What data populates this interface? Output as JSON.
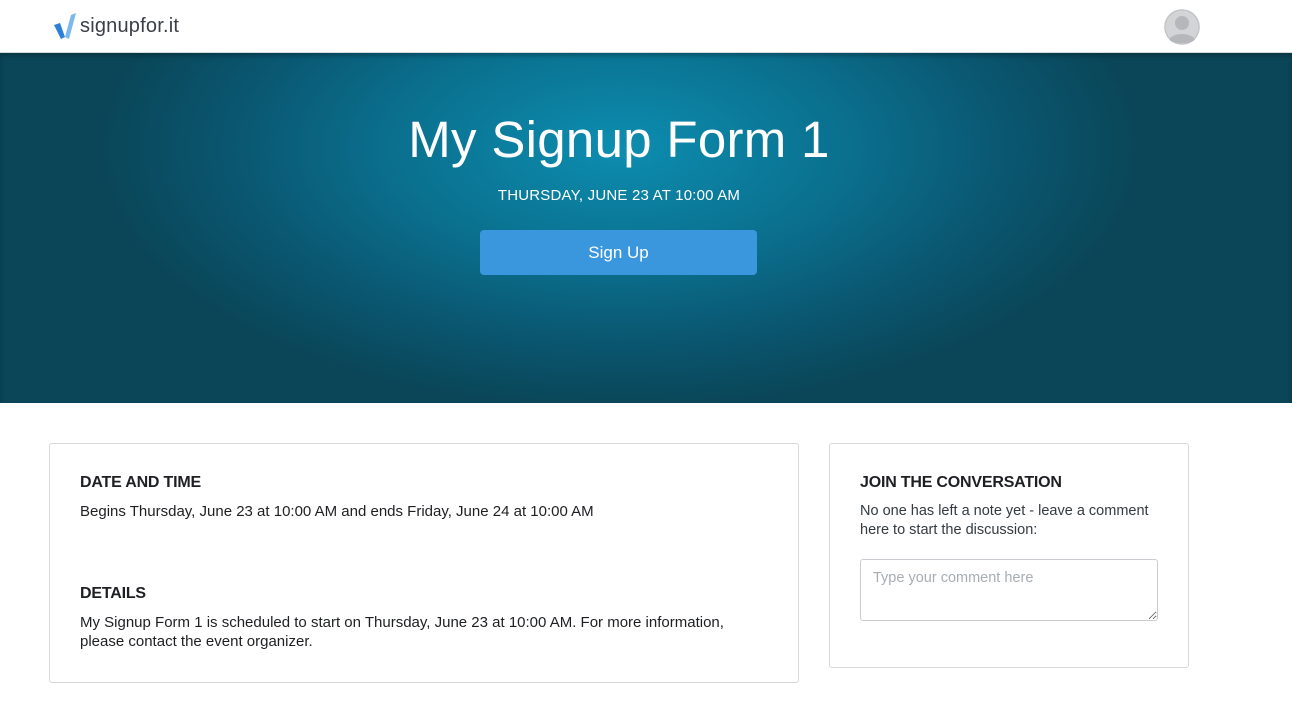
{
  "header": {
    "logo_text": "signupfor.it",
    "logo_icon": "check-mark-logo-icon",
    "avatar_icon": "user-avatar-icon"
  },
  "hero": {
    "title": "My Signup Form 1",
    "datetime": "THURSDAY, JUNE 23 AT 10:00 AM",
    "signup_button": "Sign Up"
  },
  "details_card": {
    "date_heading": "DATE AND TIME",
    "date_text": "Begins Thursday, June 23 at 10:00 AM and ends Friday, June 24 at 10:00 AM",
    "details_heading": "DETAILS",
    "details_text_line1": "My Signup Form 1 is scheduled to start on Thursday, June 23 at 10:00 AM. For more information,",
    "details_text_line2": "please contact the event organizer."
  },
  "conversation_card": {
    "heading": "JOIN THE CONVERSATION",
    "note_line1": "No one has left a note yet - leave a comment",
    "note_line2": "here to start the discussion:",
    "comment_placeholder": "Type your comment here",
    "comment_value": ""
  },
  "colors": {
    "accent_button": "#3b97dd",
    "hero_center": "#0d8db0",
    "hero_edge": "#0a4658"
  }
}
